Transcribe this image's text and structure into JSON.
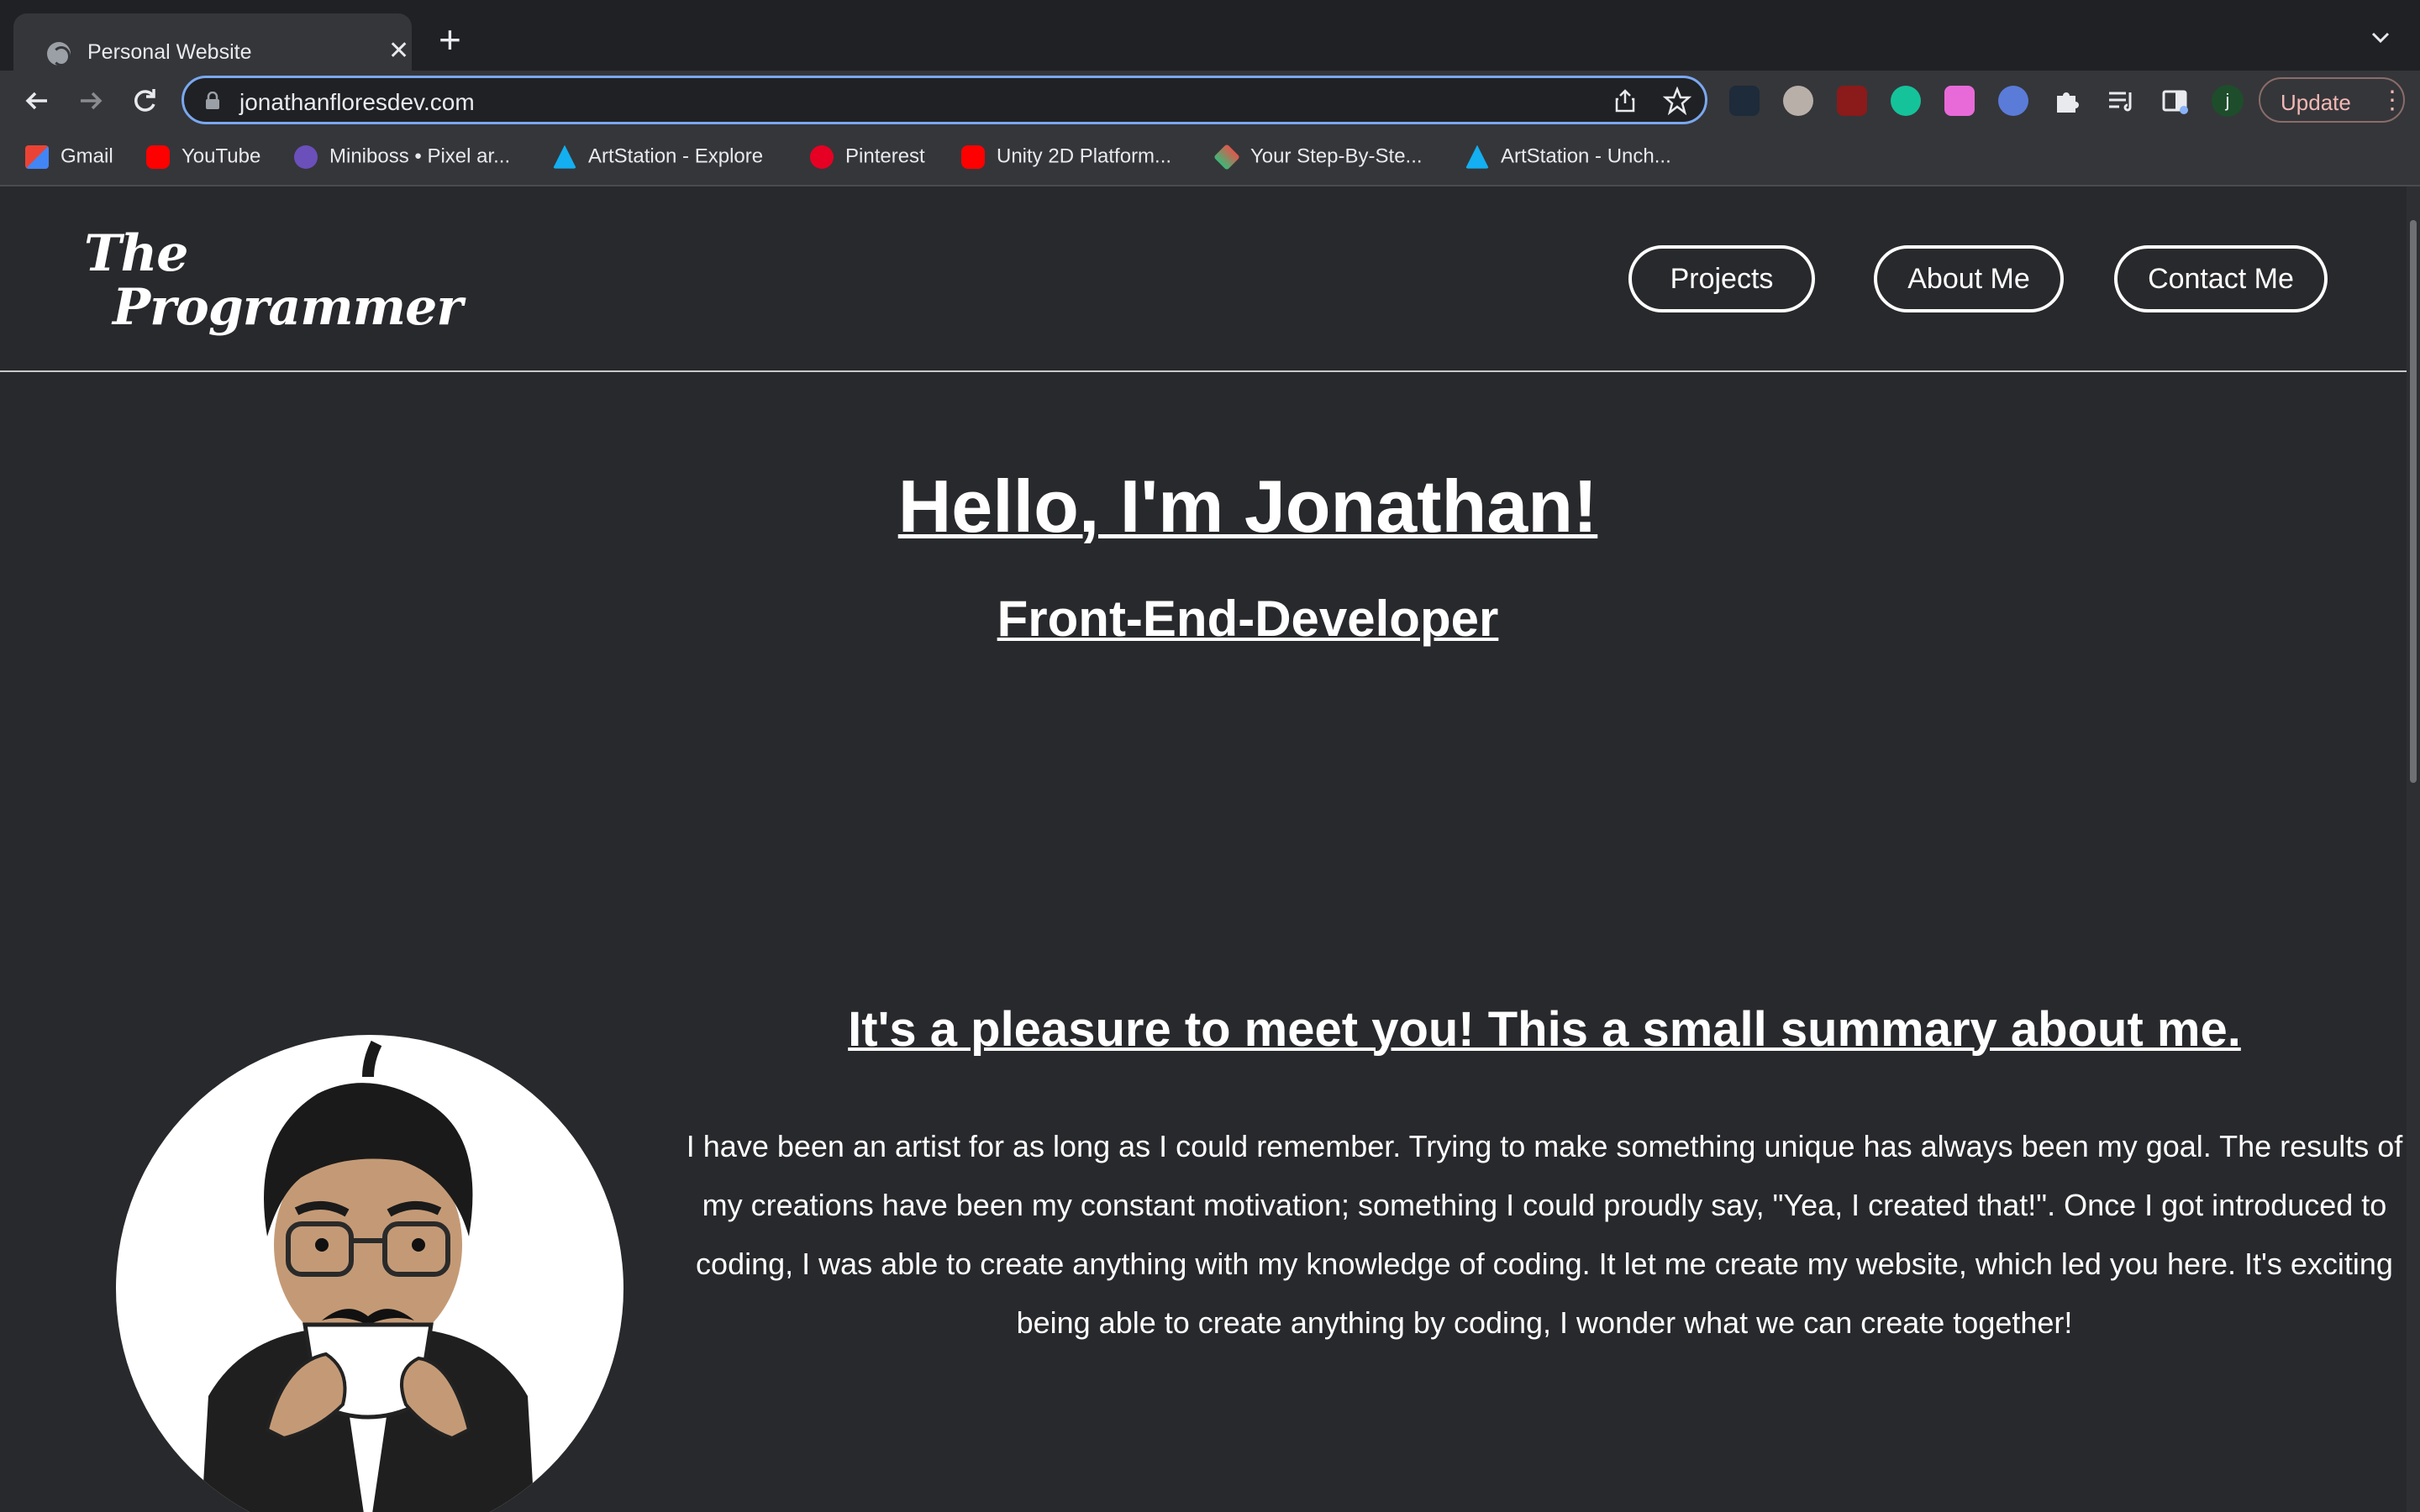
{
  "browser": {
    "tab_title": "Personal Website",
    "url": "jonathanfloresdev.com",
    "update_label": "Update",
    "profile_initial": "j",
    "bookmarks": [
      {
        "label": "Gmail",
        "icon": "gmail-icon"
      },
      {
        "label": "YouTube",
        "icon": "youtube-icon"
      },
      {
        "label": "Miniboss • Pixel ar...",
        "icon": "miniboss-icon"
      },
      {
        "label": "ArtStation - Explore",
        "icon": "artstation-icon"
      },
      {
        "label": "Pinterest",
        "icon": "pinterest-icon"
      },
      {
        "label": "Unity 2D Platform...",
        "icon": "youtube-icon"
      },
      {
        "label": "Your Step-By-Ste...",
        "icon": "layers-icon"
      },
      {
        "label": "ArtStation - Unch...",
        "icon": "artstation-icon"
      }
    ]
  },
  "site": {
    "logo_line1": "The",
    "logo_line2": "Programmer",
    "nav": [
      "Projects",
      "About Me",
      "Contact Me"
    ],
    "hero_title": "Hello, I'm Jonathan!",
    "hero_subtitle": "Front-End-Developer",
    "summary_title": "It's a pleasure to meet you! This a small summary about me.",
    "summary_text": "I have been an artist for as long as I could remember. Trying to make something unique has always been my goal. The results of my creations have been my constant motivation; something I could proudly say, \"Yea, I created that!\". Once I got introduced to coding, I was able to create anything with my knowledge of coding. It let me create my website, which led you here. It's exciting being able to create anything by coding, I wonder what we can create together!"
  },
  "colors": {
    "page_bg": "#28292c",
    "text": "#ffffff",
    "omnibox_focus": "#7aa8f0"
  }
}
